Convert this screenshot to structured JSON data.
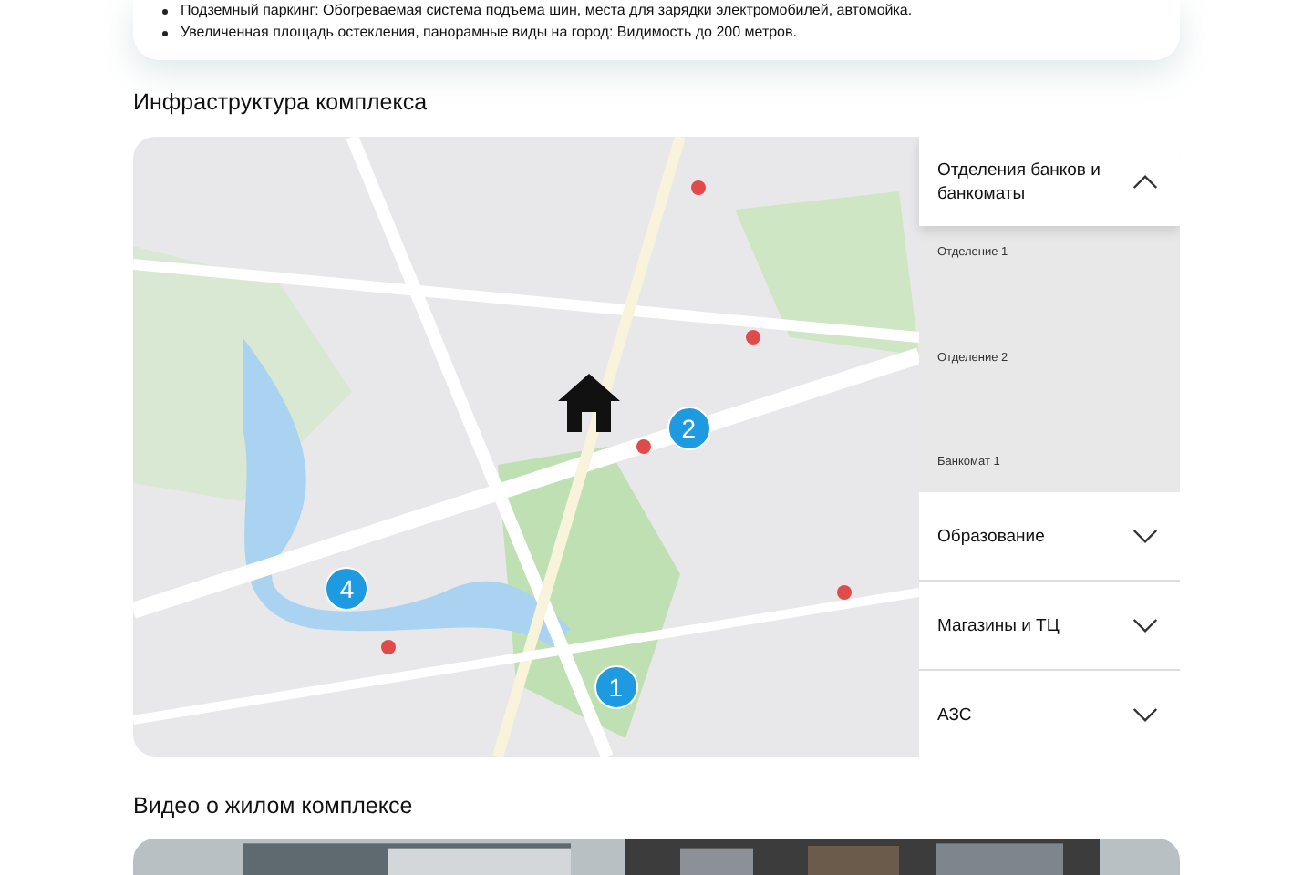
{
  "features": [
    "Подземный паркинг: Обогреваемая система подъема шин, места для зарядки электромобилей, автомойка.",
    "Увеличенная площадь остекления, панорамные виды на город: Видимость до 200 метров."
  ],
  "infrastructure": {
    "title": "Инфраструктура комплекса",
    "markers": [
      {
        "label": "2"
      },
      {
        "label": "4"
      },
      {
        "label": "1"
      }
    ],
    "categories": [
      {
        "label": "Отделения банков и банкоматы",
        "expanded": true,
        "items": [
          "Отделение 1",
          "Отделение 2",
          "Банкомат 1"
        ]
      },
      {
        "label": "Образование",
        "expanded": false
      },
      {
        "label": "Магазины и ТЦ",
        "expanded": false
      },
      {
        "label": "АЗС",
        "expanded": false
      }
    ]
  },
  "video": {
    "title": "Видео о жилом комплексе",
    "kind": "picture"
  }
}
